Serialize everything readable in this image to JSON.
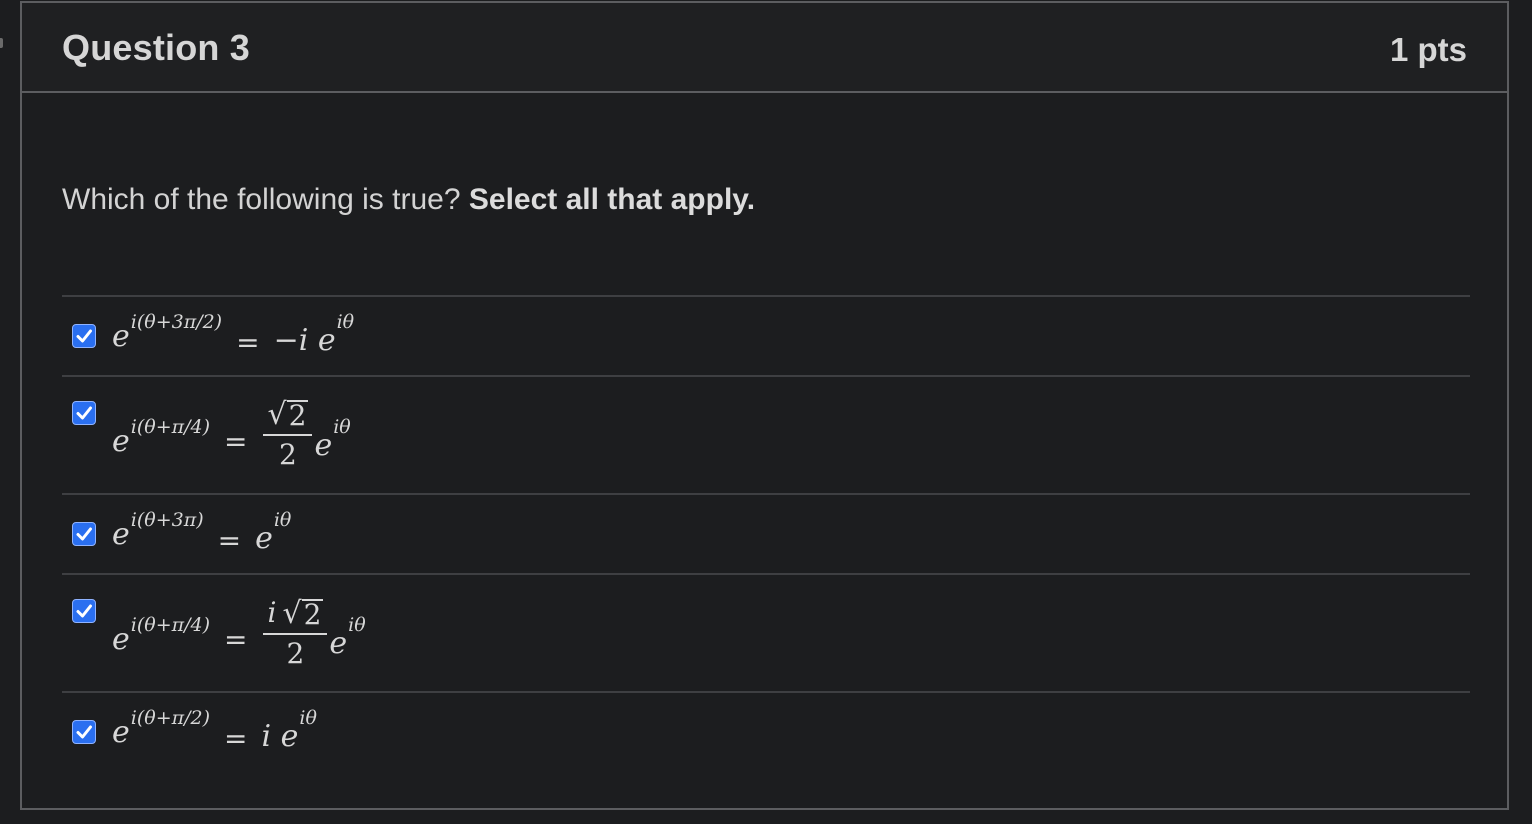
{
  "question": {
    "title": "Question 3",
    "points": "1 pts",
    "prompt_plain": "Which of the following is true?",
    "prompt_bold": "Select all that apply."
  },
  "answers": [
    {
      "checked": true,
      "base": "e",
      "exponent": "i(θ+3π/2)",
      "equals": "=",
      "rhs": "−i e",
      "rhs_exponent": "iθ"
    },
    {
      "checked": true,
      "base": "e",
      "exponent": "i(θ+π/4)",
      "equals": "=",
      "numerator_prefix": "",
      "sqrt_symbol": "√",
      "sqrt_value": "2",
      "denominator": "2",
      "rhs": "e",
      "rhs_exponent": "iθ"
    },
    {
      "checked": true,
      "base": "e",
      "exponent": "i(θ+3π)",
      "equals": "=",
      "rhs": "e",
      "rhs_exponent": "iθ"
    },
    {
      "checked": true,
      "base": "e",
      "exponent": "i(θ+π/4)",
      "equals": "=",
      "numerator_prefix": "i",
      "sqrt_symbol": "√",
      "sqrt_value": "2",
      "denominator": "2",
      "rhs": "e",
      "rhs_exponent": "iθ"
    },
    {
      "checked": true,
      "base": "e",
      "exponent": "i(θ+π/2)",
      "equals": "=",
      "rhs": "i e",
      "rhs_exponent": "iθ"
    }
  ],
  "colors": {
    "checkbox_fill": "#2a6ff0",
    "background": "#1c1d1f",
    "border": "#5c5d60"
  }
}
